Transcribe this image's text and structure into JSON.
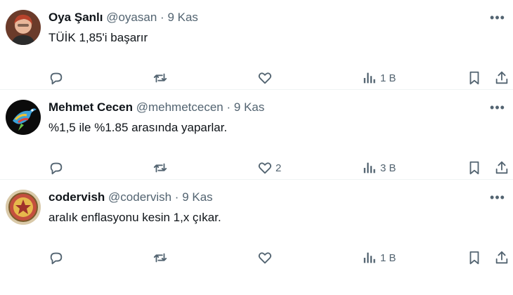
{
  "tweets": [
    {
      "name": "Oya Şanlı",
      "handle": "@oyasan",
      "separator": "·",
      "date": "9 Kas",
      "text": "TÜİK 1,85'i başarır",
      "replies": "",
      "retweets": "",
      "likes": "",
      "views": "1 B",
      "avatar": "woman-portrait"
    },
    {
      "name": "Mehmet Cecen",
      "handle": "@mehmetcecen",
      "separator": "·",
      "date": "9 Kas",
      "text": "%1,5 ile %1.85 arasında yaparlar.",
      "replies": "",
      "retweets": "",
      "likes": "2",
      "views": "3 B",
      "avatar": "colorful-bird"
    },
    {
      "name": "codervish",
      "handle": "@codervish",
      "separator": "·",
      "date": "9 Kas",
      "text": "aralık enflasyonu kesin 1,x çıkar.",
      "replies": "",
      "retweets": "",
      "likes": "",
      "views": "1 B",
      "avatar": "emblem-seal"
    }
  ],
  "colors": {
    "text": "#0f1419",
    "secondary": "#536471",
    "divider": "#eff3f4"
  },
  "icons": [
    "reply-icon",
    "retweet-icon",
    "like-icon",
    "views-icon",
    "bookmark-icon",
    "share-icon",
    "more-icon"
  ]
}
